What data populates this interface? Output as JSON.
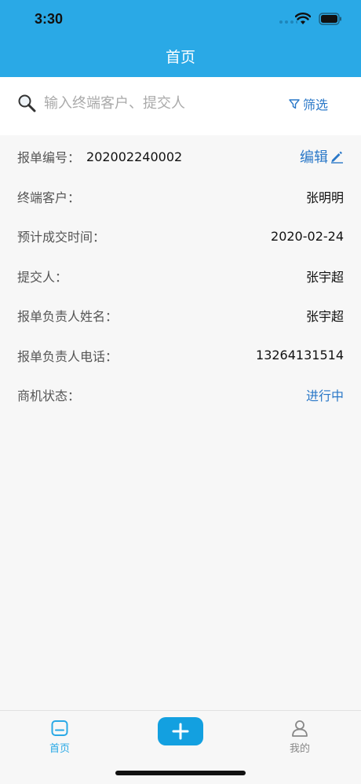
{
  "status": {
    "time": "3:30"
  },
  "nav": {
    "title": "首页"
  },
  "search": {
    "placeholder": "输入终端客户、提交人",
    "filter_label": "筛选"
  },
  "detail": {
    "order_no_label": "报单编号：",
    "order_no_value": "202002240002",
    "edit_label": "编辑",
    "rows": [
      {
        "label": "终端客户：",
        "value": "张明明"
      },
      {
        "label": "预计成交时间：",
        "value": "2020-02-24"
      },
      {
        "label": "提交人：",
        "value": "张宇超"
      },
      {
        "label": "报单负责人姓名：",
        "value": "张宇超"
      },
      {
        "label": "报单负责人电话：",
        "value": "13264131514"
      },
      {
        "label": "商机状态：",
        "value": "进行中"
      }
    ]
  },
  "tabbar": {
    "home_label": "首页",
    "mine_label": "我的"
  },
  "colors": {
    "header": "#2aa9e6",
    "link": "#2a78c8",
    "tab_active": "#2aa9e6",
    "add_button": "#13a0e0"
  }
}
